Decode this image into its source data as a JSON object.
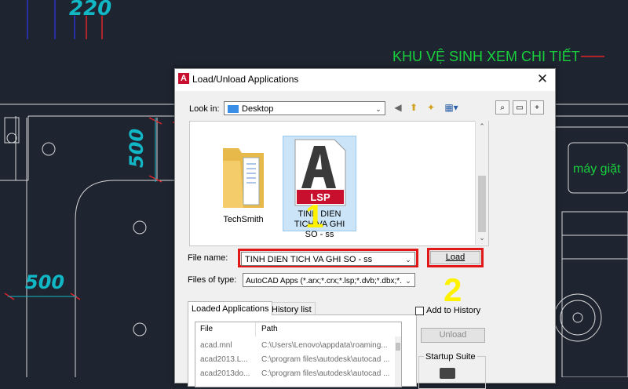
{
  "background": {
    "dimension_top": "220",
    "dimension_left": "500",
    "dimension_bottom": "500",
    "note_title": "KHU VỆ SINH XEM CHI TIẾT",
    "note_right": "máy giặt",
    "colors": {
      "canvas": "#1e2430",
      "dimension": "#12b7c6",
      "note": "#19d13d",
      "tick": "#e0242a"
    }
  },
  "dialog": {
    "title": "Load/Unload Applications",
    "app_icon": "A",
    "close_icon": "close-icon",
    "look_in_label": "Look in:",
    "look_in_value": "Desktop",
    "toolbar_icons": [
      "back-icon",
      "up-folder-icon",
      "new-folder-icon",
      "views-icon",
      "search-web-icon",
      "find-icon",
      "add-favorites-icon"
    ],
    "files": [
      {
        "name": "TechSmith",
        "icon": "folder-icon",
        "selected": false
      },
      {
        "name": "TINH DIEN TICH VA GHI SO - ss",
        "icon": "lsp-file-icon",
        "badge": "LSP",
        "selected": true
      }
    ],
    "file_name_label": "File name:",
    "file_name_value": "TINH DIEN TICH VA GHI SO - ss",
    "files_of_type_label": "Files of type:",
    "files_of_type_value": "AutoCAD Apps (*.arx;*.crx;*.lsp;*.dvb;*.dbx;*.",
    "load_button": "Load",
    "tabs": [
      "Loaded Applications",
      "History list"
    ],
    "list_headers": [
      "File",
      "Path"
    ],
    "list_rows": [
      {
        "file": "acad.mnl",
        "path": "C:\\Users\\Lenovo\\appdata\\roaming..."
      },
      {
        "file": "acad2013.L...",
        "path": "C:\\program files\\autodesk\\autocad ..."
      },
      {
        "file": "acad2013do...",
        "path": "C:\\program files\\autodesk\\autocad ..."
      }
    ],
    "add_to_history_label": "Add to History",
    "unload_button": "Unload",
    "startup_suite_label": "Startup Suite",
    "step_markers": [
      "1",
      "2"
    ],
    "highlight_color": "#e01818",
    "step_color": "#fff200"
  }
}
